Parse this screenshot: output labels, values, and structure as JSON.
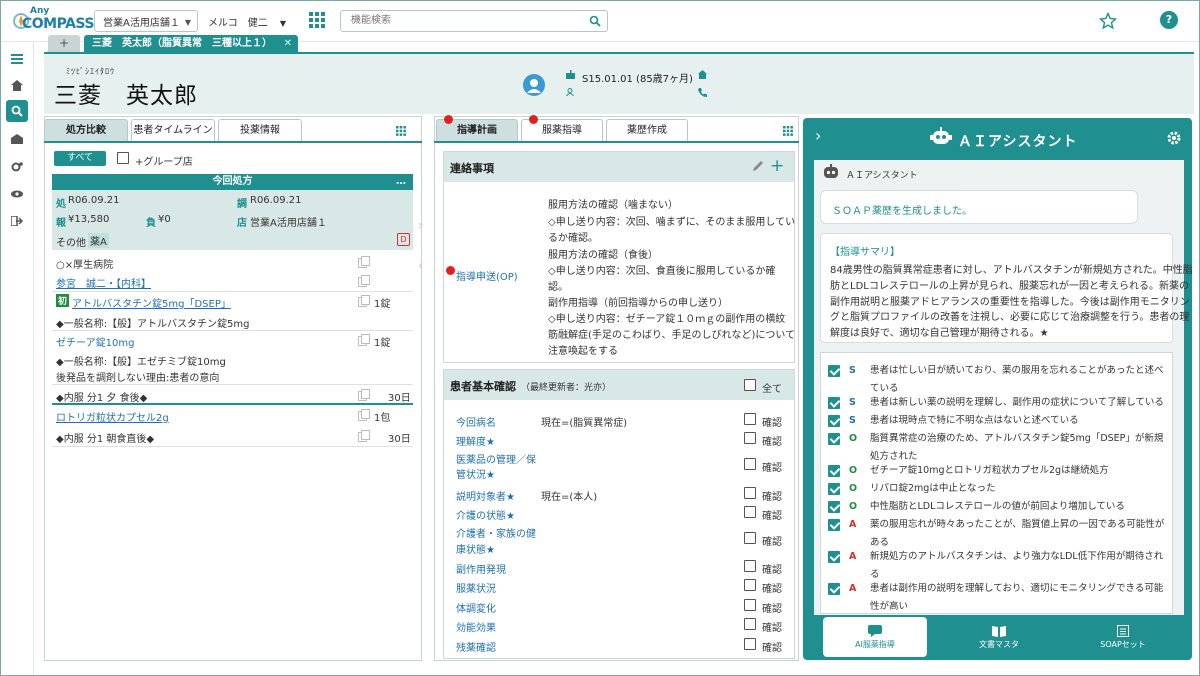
{
  "app": {
    "logo_any": "Any",
    "logo_compass": "COMPASS"
  },
  "topbar": {
    "store_select": "営業A活用店舗１",
    "user": "メルコ　健二",
    "search_placeholder": "機能検索"
  },
  "tabs": {
    "plus": "+",
    "patient_tab": "三菱　英太郎（脂質異常　三種以上１）",
    "close": "✕"
  },
  "patient": {
    "kana": "ﾐﾂﾋﾞｼｴｲﾀﾛｳ",
    "name": "三菱　英太郎",
    "dob": "S15.01.01 (85歳7ヶ月)"
  },
  "left_panel": {
    "tabs": [
      "処方比較",
      "患者タイムライン",
      "投薬情報"
    ],
    "all_button": "すべて",
    "group_store_label": "+グループ店",
    "current_rx_title": "今回処方",
    "more": "…",
    "info": {
      "sho_label": "処",
      "sho_date": "R06.09.21",
      "cho_label": "調",
      "cho_date": "R06.09.21",
      "ho_label": "報",
      "ho_value": "¥13,580",
      "fu_label": "負",
      "fu_value": "¥0",
      "ten_label": "店",
      "ten_value": "営業A活用店舗１",
      "other_label": "その他",
      "other_value": "薬A",
      "d_badge": "D"
    },
    "hospital": "○×厚生病院",
    "doctor": "参宮　誠二・【内科】",
    "first_badge": "初",
    "drug1": "アトルバスタチン錠5mg「DSEP」",
    "drug1_qty": "1錠",
    "drug1_generic": "◆一般名称:【般】アトルバスタチン錠5mg",
    "drug2": "ゼチーア錠10mg",
    "drug2_qty": "1錠",
    "drug2_generic": "◆一般名称:【般】エゼチミブ錠10mg",
    "drug2_note": "後発品を調剤しない理由:患者の意向",
    "usage1": "◆内服 分1 夕 食後◆",
    "usage1_days": "30日",
    "drug3": "ロトリガ粒状カプセル2g",
    "drug3_qty": "1包",
    "usage2": "◆内服 分1 朝食直後◆",
    "usage2_days": "30日"
  },
  "mid_panel": {
    "tabs": [
      "指導計画",
      "服薬指導",
      "薬歴作成"
    ],
    "contact_title": "連絡事項",
    "op_label": "指導申送(OP)",
    "contact_lines": [
      "服用方法の確認（噛まない）",
      "◇申し送り内容：次回、噛まずに、そのまま服用してい",
      "るか確認。",
      "服用方法の確認（食後）",
      "◇申し送り内容：次回、食直後に服用しているか確",
      "認。",
      "副作用指導（前回指導からの申し送り）",
      "◇申し送り内容：ゼチーア錠１０ｍｇの副作用の横紋",
      "筋融解症(手足のこわばり、手足のしびれなど)について",
      "注意喚起をする"
    ],
    "basic_title": "患者基本確認",
    "basic_updater": "（最終更新者：光亦）",
    "all_label": "全て",
    "confirm": "確認",
    "items": [
      {
        "label": "今回病名",
        "value": "現在=(脂質異常症)"
      },
      {
        "label": "理解度★",
        "value": ""
      },
      {
        "label": "医薬品の管理／保",
        "label2": "管状況★",
        "value": ""
      },
      {
        "label": "説明対象者★",
        "value": "現在=(本人)"
      },
      {
        "label": "介護の状態★",
        "value": ""
      },
      {
        "label": "介護者・家族の健",
        "label2": "康状態★",
        "value": ""
      },
      {
        "label": "副作用発現",
        "value": ""
      },
      {
        "label": "服薬状況",
        "value": ""
      },
      {
        "label": "体調変化",
        "value": ""
      },
      {
        "label": "効能効果",
        "value": ""
      },
      {
        "label": "残薬確認",
        "value": ""
      }
    ]
  },
  "ai": {
    "title": "ＡＩアシスタント",
    "sub_title": "ＡＩアシスタント",
    "message": "ＳＯＡＰ薬歴を生成しました。",
    "summary_title": "【指導サマリ】",
    "summary_lines": [
      "84歳男性の脂質異常症患者に対し、アトルバスタチンが新規処方された。中性脂",
      "肪とLDLコレステロールの上昇が見られ、服薬忘れが一因と考えられる。新薬の",
      "副作用説明と服薬アドヒアランスの重要性を指導した。今後は副作用モニタリン",
      "グと脂質プロファイルの改善を注視し、必要に応じて治療調整を行う。患者の理",
      "解度は良好で、適切な自己管理が期待される。★"
    ],
    "soap": [
      {
        "tag": "S",
        "text": "患者は忙しい日が続いており、薬の服用を忘れることがあったと述べている"
      },
      {
        "tag": "S",
        "text": "患者は新しい薬の説明を理解し、副作用の症状について了解している"
      },
      {
        "tag": "S",
        "text": "患者は現時点で特に不明な点はないと述べている"
      },
      {
        "tag": "O",
        "text": "脂質異常症の治療のため、アトルバスタチン錠5mg「DSEP」が新規処方された"
      },
      {
        "tag": "O",
        "text": "ゼチーア錠10mgとロトリガ粒状カプセル2gは継続処方"
      },
      {
        "tag": "O",
        "text": "リパロ錠2mgは中止となった"
      },
      {
        "tag": "O",
        "text": "中性脂肪とLDLコレステロールの値が前回より増加している"
      },
      {
        "tag": "A",
        "text": "薬の服用忘れが時々あったことが、脂質値上昇の一因である可能性がある"
      },
      {
        "tag": "A",
        "text": "新規処方のアトルバスタチンは、より強力なLDL低下作用が期待される"
      },
      {
        "tag": "A",
        "text": "患者は副作用の説明を理解しており、適切にモニタリングできる可能性が高い"
      }
    ],
    "bottom": [
      "AI服薬指導",
      "文書マスタ",
      "SOAPセット"
    ]
  },
  "colors": {
    "teal": "#1f8f8f",
    "S": "#1f6fb0",
    "O": "#1f8f3f",
    "A": "#d03030"
  }
}
